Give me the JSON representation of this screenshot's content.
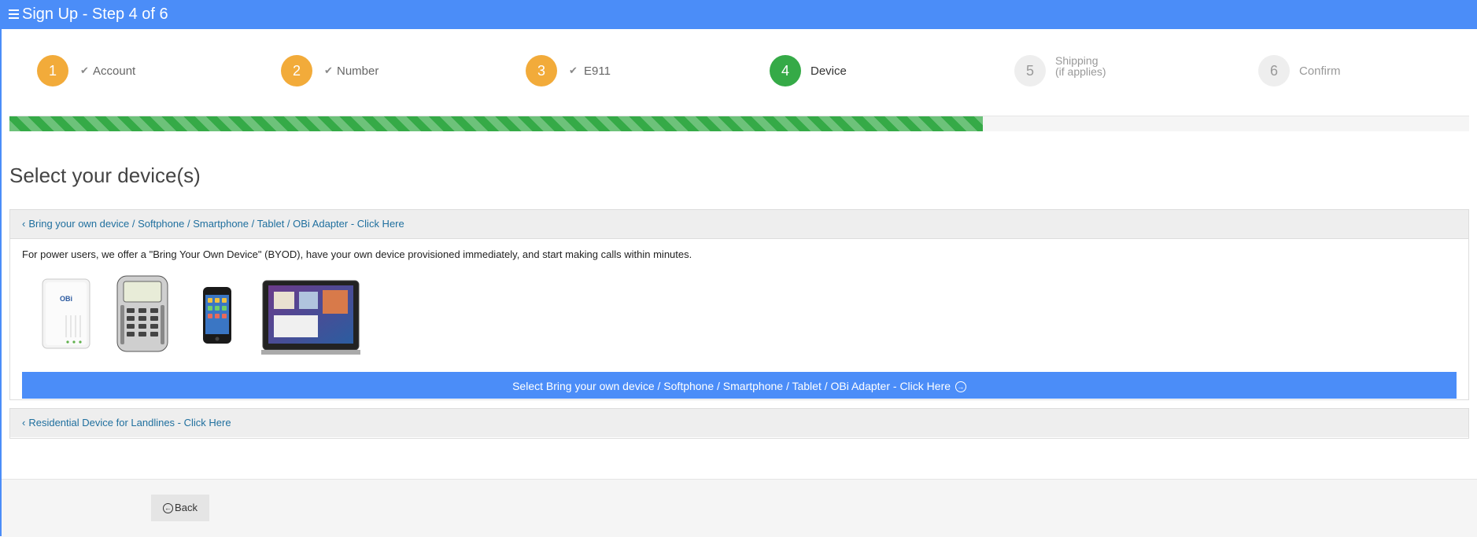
{
  "header": {
    "title": "Sign Up - Step 4 of 6",
    "menu_icon": "hamburger-icon"
  },
  "steps": [
    {
      "number": "1",
      "label": "Account",
      "state": "done"
    },
    {
      "number": "2",
      "label": "Number",
      "state": "done"
    },
    {
      "number": "3",
      "label": "E911",
      "state": "done"
    },
    {
      "number": "4",
      "label": "Device",
      "state": "active"
    },
    {
      "number": "5",
      "label_line1": "Shipping",
      "label_line2": "(if applies)",
      "state": "todo"
    },
    {
      "number": "6",
      "label": "Confirm",
      "state": "todo"
    }
  ],
  "progress": {
    "percent": 66.7
  },
  "colors": {
    "primary": "#4b8df8",
    "done": "#f2ab3a",
    "active": "#35aa47",
    "todo": "#eeeeee"
  },
  "page": {
    "heading": "Select your device(s)"
  },
  "byod_panel": {
    "header": "Bring your own device / Softphone / Smartphone / Tablet / OBi Adapter - Click Here",
    "description": "For power users, we offer a \"Bring Your Own Device\" (BYOD), have your own device provisioned immediately, and start making calls within minutes.",
    "devices": [
      "OBi adapter",
      "Polycom IP phone",
      "iPhone",
      "Tablet"
    ],
    "select_button": "Select Bring your own device / Softphone / Smartphone / Tablet / OBi Adapter - Click Here"
  },
  "residential_panel": {
    "header": "Residential Device for Landlines - Click Here"
  },
  "footer": {
    "back_label": "Back"
  }
}
